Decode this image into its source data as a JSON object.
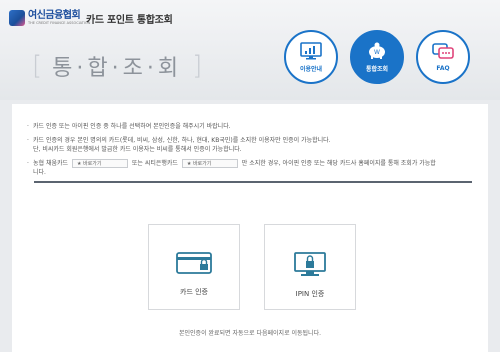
{
  "header": {
    "logo_name": "여신금융협회",
    "logo_sub": "THE CREDIT FINANCE ASSOCIATION",
    "site_title": "카드 포인트 통합조회",
    "page_title": "통·합·조·회",
    "bracket_open": "[",
    "bracket_close": "]"
  },
  "nav": [
    {
      "label": "이용안내",
      "icon": "chart-monitor-icon",
      "active": false
    },
    {
      "label": "통합조회",
      "icon": "piggy-bank-icon",
      "active": true
    },
    {
      "label": "FAQ",
      "icon": "chat-bubble-icon",
      "active": false
    }
  ],
  "notices": {
    "bullet": "·",
    "n1": "카드 인증 또는 아이핀 인증 중 하나를 선택하여 본인인증을 해주시기 바랍니다.",
    "n2a": "카드 인증의 경우 본인 명의의 카드(롯데, 비씨, 삼성, 신한, 하나, 현대, KB국민)를 소지한 이용자만 인증이 가능합니다.",
    "n2b": "단, 비씨카드 회원은행에서 발급한 카드 이용자는 비씨를 통해서 인증이 가능합니다.",
    "n3_pre": "농협 채움카드",
    "n3_btn1": "바로가기",
    "n3_mid": "또는 씨티은행카드",
    "n3_btn2": "바로가기",
    "n3_post": "만 소지한 경우, 아이핀 인증 또는 해당 카드사 홈페이지를 통해 조회가 가능합",
    "n3_end": "니다."
  },
  "auth": {
    "card_label": "카드 인증",
    "ipin_label": "IPIN 인증"
  },
  "footer_note": "본인인증이 완료되면 자동으로 다음페이지로 이동됩니다.",
  "colors": {
    "brand_blue": "#1a73c8",
    "divider": "#5b6470",
    "icon_teal": "#2c7a9a"
  }
}
